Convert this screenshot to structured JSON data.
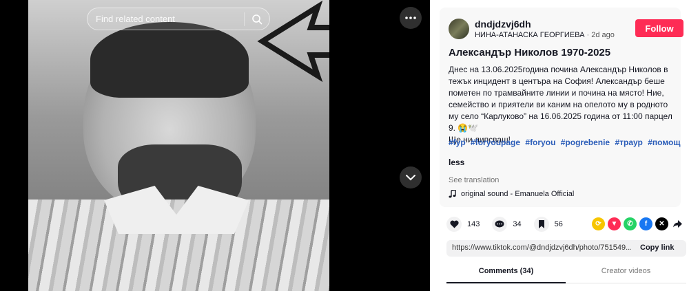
{
  "search": {
    "placeholder": "Find related content"
  },
  "author": {
    "username": "dndjdzvj6dh",
    "nickname": "НИНА-АТАНАСКА ГЕОРГИЕВА",
    "separator": "·",
    "time_ago": "2d ago",
    "follow_label": "Follow"
  },
  "post": {
    "title": "Александър Николов 1970-2025",
    "body_line1": "Днес на 13.06.2025година почина Александър Николов в тежък инцидент в центъра на София! Александър беше пометен по трамвайните линии и почина на място! Ние, семейство и приятели ви каним на опелото му в родното му село “Карлуково” на 16.06.2025 година от 11:00 парцел 9. 😭🕊️",
    "body_line2": "Ще ни липсваш!",
    "hashtags": [
      "#fyp",
      "#foryoupage",
      "#foryou",
      "#pogrebenie",
      "#траур",
      "#помощ"
    ],
    "less_label": "less",
    "see_translation": "See translation",
    "sound": "original sound - Emanuela Official"
  },
  "stats": {
    "likes": "143",
    "comments": "34",
    "saves": "56"
  },
  "share": {
    "link": "https://www.tiktok.com/@dndjdzvj6dh/photo/751549...",
    "copy_label": "Copy link",
    "icons": [
      "repost-icon",
      "pinterest-icon",
      "whatsapp-icon",
      "facebook-icon",
      "x-icon",
      "share-arrow-icon"
    ],
    "colors": {
      "repost": "#f7c500",
      "pinterest": "#fe2c55",
      "whatsapp": "#25d366",
      "facebook": "#1877f2",
      "x": "#000000"
    }
  },
  "tabs": {
    "comments": "Comments (34)",
    "creator_videos": "Creator videos"
  },
  "colors": {
    "accent": "#fe2c55",
    "hashtag": "#2b5db9"
  }
}
